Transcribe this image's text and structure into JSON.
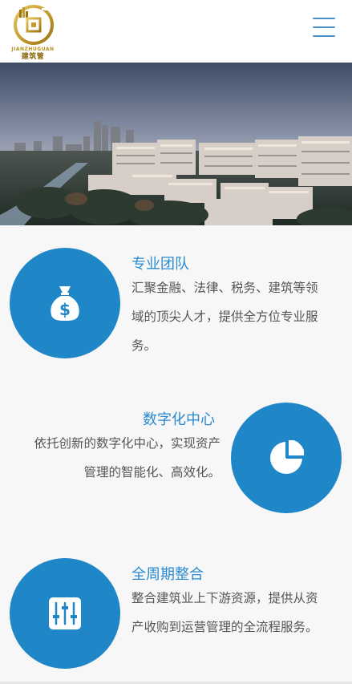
{
  "brand": {
    "logo_text": "建筑管",
    "logo_sub": "JIANZHUGUAN"
  },
  "hero": {
    "image": "city-skyline-photo"
  },
  "features": [
    {
      "icon": "money-bag-icon",
      "title": "专业团队",
      "desc_lines": [
        "汇聚金融、法律、税务、建筑等领",
        "域的顶尖人才，提供全方位专业服",
        "务。"
      ]
    },
    {
      "icon": "pie-chart-icon",
      "title": "数字化中心",
      "desc_lines": [
        "依托创新的数字化中心，实现资产",
        "管理的智能化、高效化。"
      ]
    },
    {
      "icon": "sliders-icon",
      "title": "全周期整合",
      "desc_lines": [
        "整合建筑业上下游资源，提供从资",
        "产收购到运营管理的全流程服务。"
      ]
    }
  ],
  "colors": {
    "accent": "#1f87c8",
    "title": "#2a8ad0",
    "gold": "#b8921e",
    "menu": "#4a90c9"
  }
}
